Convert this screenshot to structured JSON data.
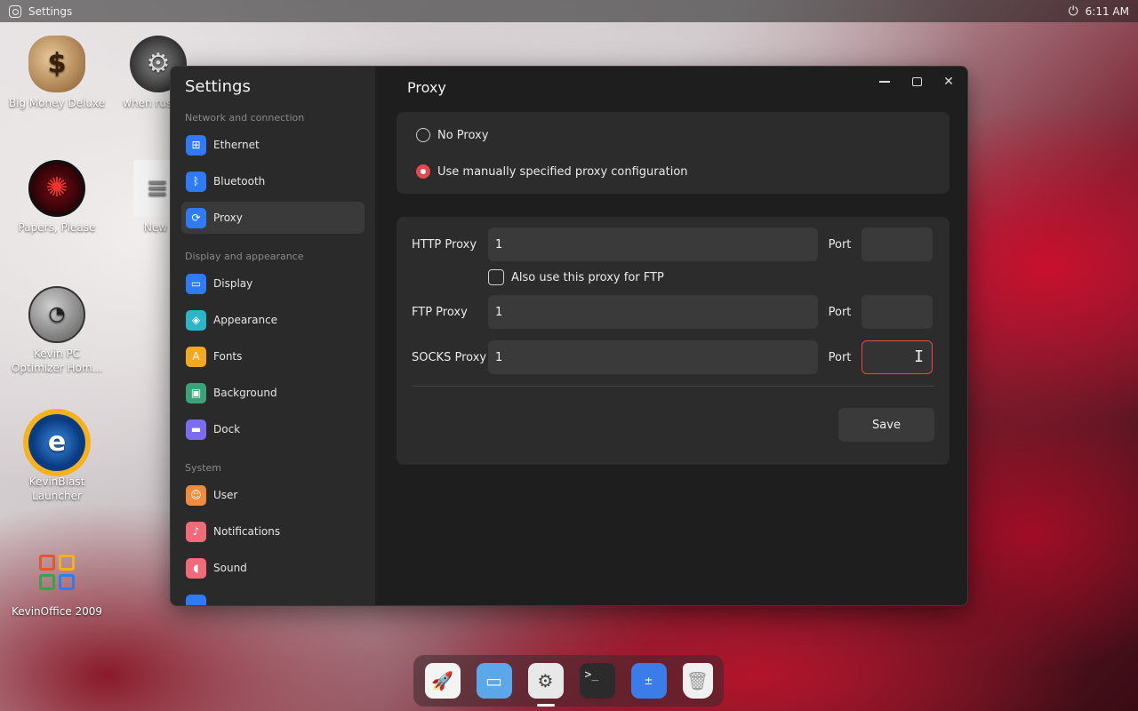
{
  "topbar": {
    "app_name": "Settings",
    "time": "6:11 AM",
    "power_glyph": "⏻"
  },
  "desktop": {
    "icons": [
      {
        "label": "Big Money Deluxe",
        "glyph": "$"
      },
      {
        "label": "Papers, Please",
        "glyph": "✺"
      },
      {
        "label": "Kevin PC Optimizer Hom...",
        "glyph": "◔"
      },
      {
        "label": "KevinBlast Launcher",
        "glyph": "e"
      },
      {
        "label": "KevinOffice 2009",
        "glyph": ""
      },
      {
        "label": "when russian",
        "glyph": "⚙"
      },
      {
        "label": "New",
        "glyph": "≡"
      }
    ]
  },
  "window": {
    "sidebar_title": "Settings",
    "sections": [
      {
        "label": "Network and connection",
        "items": [
          {
            "label": "Ethernet",
            "glyph": "⊞",
            "color": "#2f7bf5"
          },
          {
            "label": "Bluetooth",
            "glyph": "ᛒ",
            "color": "#2f7bf5"
          },
          {
            "label": "Proxy",
            "glyph": "⟳",
            "color": "#2f7bf5"
          }
        ]
      },
      {
        "label": "Display and appearance",
        "items": [
          {
            "label": "Display",
            "glyph": "▭",
            "color": "#2f7bf5"
          },
          {
            "label": "Appearance",
            "glyph": "◈",
            "color": "#2bb5c9"
          },
          {
            "label": "Fonts",
            "glyph": "A",
            "color": "#f2a91e"
          },
          {
            "label": "Background",
            "glyph": "▣",
            "color": "#3aa37a"
          },
          {
            "label": "Dock",
            "glyph": "▬",
            "color": "#7b6cf0"
          }
        ]
      },
      {
        "label": "System",
        "items": [
          {
            "label": "User",
            "glyph": "☺",
            "color": "#f08a3c"
          },
          {
            "label": "Notifications",
            "glyph": "♪",
            "color": "#f06a7a"
          },
          {
            "label": "Sound",
            "glyph": "◖",
            "color": "#f06a7a"
          }
        ]
      }
    ],
    "content_title": "Proxy",
    "mode": {
      "no_proxy": "No Proxy",
      "manual": "Use manually specified proxy configuration",
      "selected": "manual"
    },
    "proxies": {
      "http_label": "HTTP Proxy",
      "http_value": "1",
      "ftp_checkbox": "Also use this proxy for FTP",
      "ftp_label": "FTP Proxy",
      "ftp_value": "1",
      "socks_label": "SOCKS Proxy",
      "socks_value": "1",
      "port_label": "Port",
      "http_port": "",
      "ftp_port": "",
      "socks_port": ""
    },
    "save_label": "Save"
  },
  "dock": {
    "items": [
      {
        "name": "launcher",
        "glyph": "🚀"
      },
      {
        "name": "files",
        "glyph": "▭"
      },
      {
        "name": "settings",
        "glyph": "⚙"
      },
      {
        "name": "terminal",
        "glyph": ">_"
      },
      {
        "name": "calculator",
        "glyph": "±"
      },
      {
        "name": "trash",
        "glyph": "🗑"
      }
    ]
  },
  "colors": {
    "accent": "#e5484d",
    "window_bg": "#1e1e1e",
    "sidebar_bg": "#2a2a2a",
    "card_bg": "#2c2c2c"
  }
}
